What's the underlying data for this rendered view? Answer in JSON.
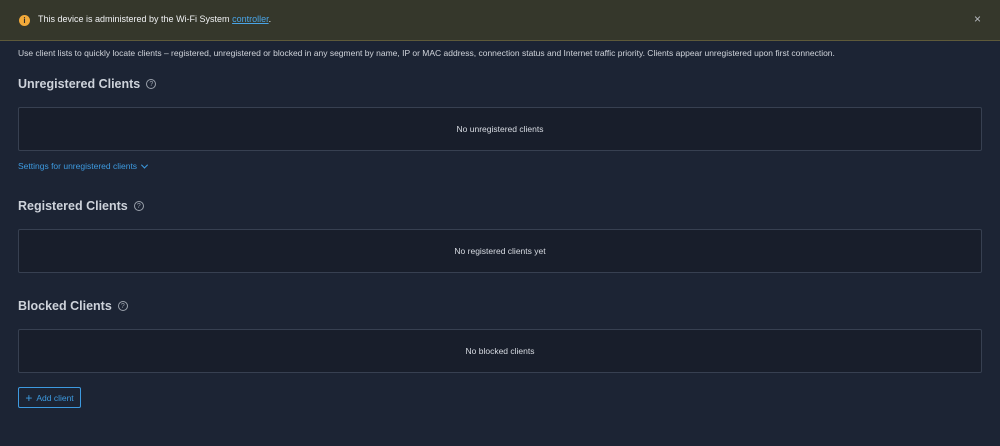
{
  "banner": {
    "message": "This device is administered by the Wi-Fi System ",
    "link": "controller",
    "suffix": ".",
    "close": "×",
    "icon": "info-icon",
    "icon_glyph": "i"
  },
  "intro": "Use client lists to quickly locate clients – registered, unregistered or blocked in any segment by name, IP or MAC address, connection status and Internet traffic priority. Clients appear unregistered upon first connection.",
  "sections": {
    "unregistered": {
      "title": "Unregistered Clients",
      "empty": "No unregistered clients"
    },
    "registered": {
      "title": "Registered Clients",
      "empty": "No registered clients yet"
    },
    "blocked": {
      "title": "Blocked Clients",
      "empty": "No blocked clients"
    }
  },
  "help_glyph": "?",
  "settings_link": "Settings for unregistered clients",
  "add_button": {
    "icon": "+",
    "label": "Add client"
  },
  "colors": {
    "accent": "#3d9ae0",
    "warning": "#f1a93a",
    "background": "#1c2434"
  }
}
